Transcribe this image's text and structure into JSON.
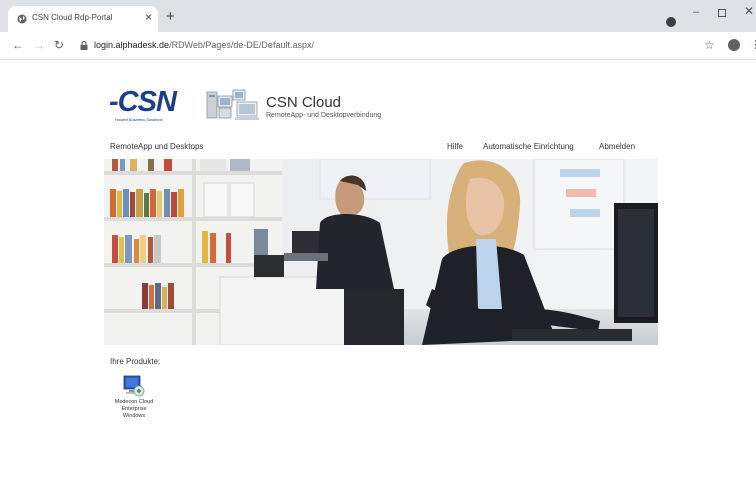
{
  "browser": {
    "tab_title": "CSN Cloud Rdp-Portal",
    "tab_close": "×",
    "new_tab": "+",
    "url_host": "login.alphadesk.de",
    "url_path": "/RDWeb/Pages/de-DE/Default.aspx/"
  },
  "header": {
    "logo_text": "-CSN",
    "logo_tagline": "Hosted Business Solutions",
    "site_title": "CSN Cloud",
    "site_subtitle": "RemoteApp- und Desktopverbindung"
  },
  "nav": {
    "section_label": "RemoteApp und Desktops",
    "links": [
      "Hilfe",
      "Automatische Einrichtung",
      "Abmelden"
    ]
  },
  "products": {
    "heading": "Ihre Produkte:",
    "items": [
      {
        "name": "Medecon Cloud Enterprise Windows",
        "icon": "remote-desktop-icon"
      }
    ]
  },
  "colors": {
    "brand": "#1b3f8c",
    "text": "#333333",
    "chrome": "#dee1e6"
  }
}
